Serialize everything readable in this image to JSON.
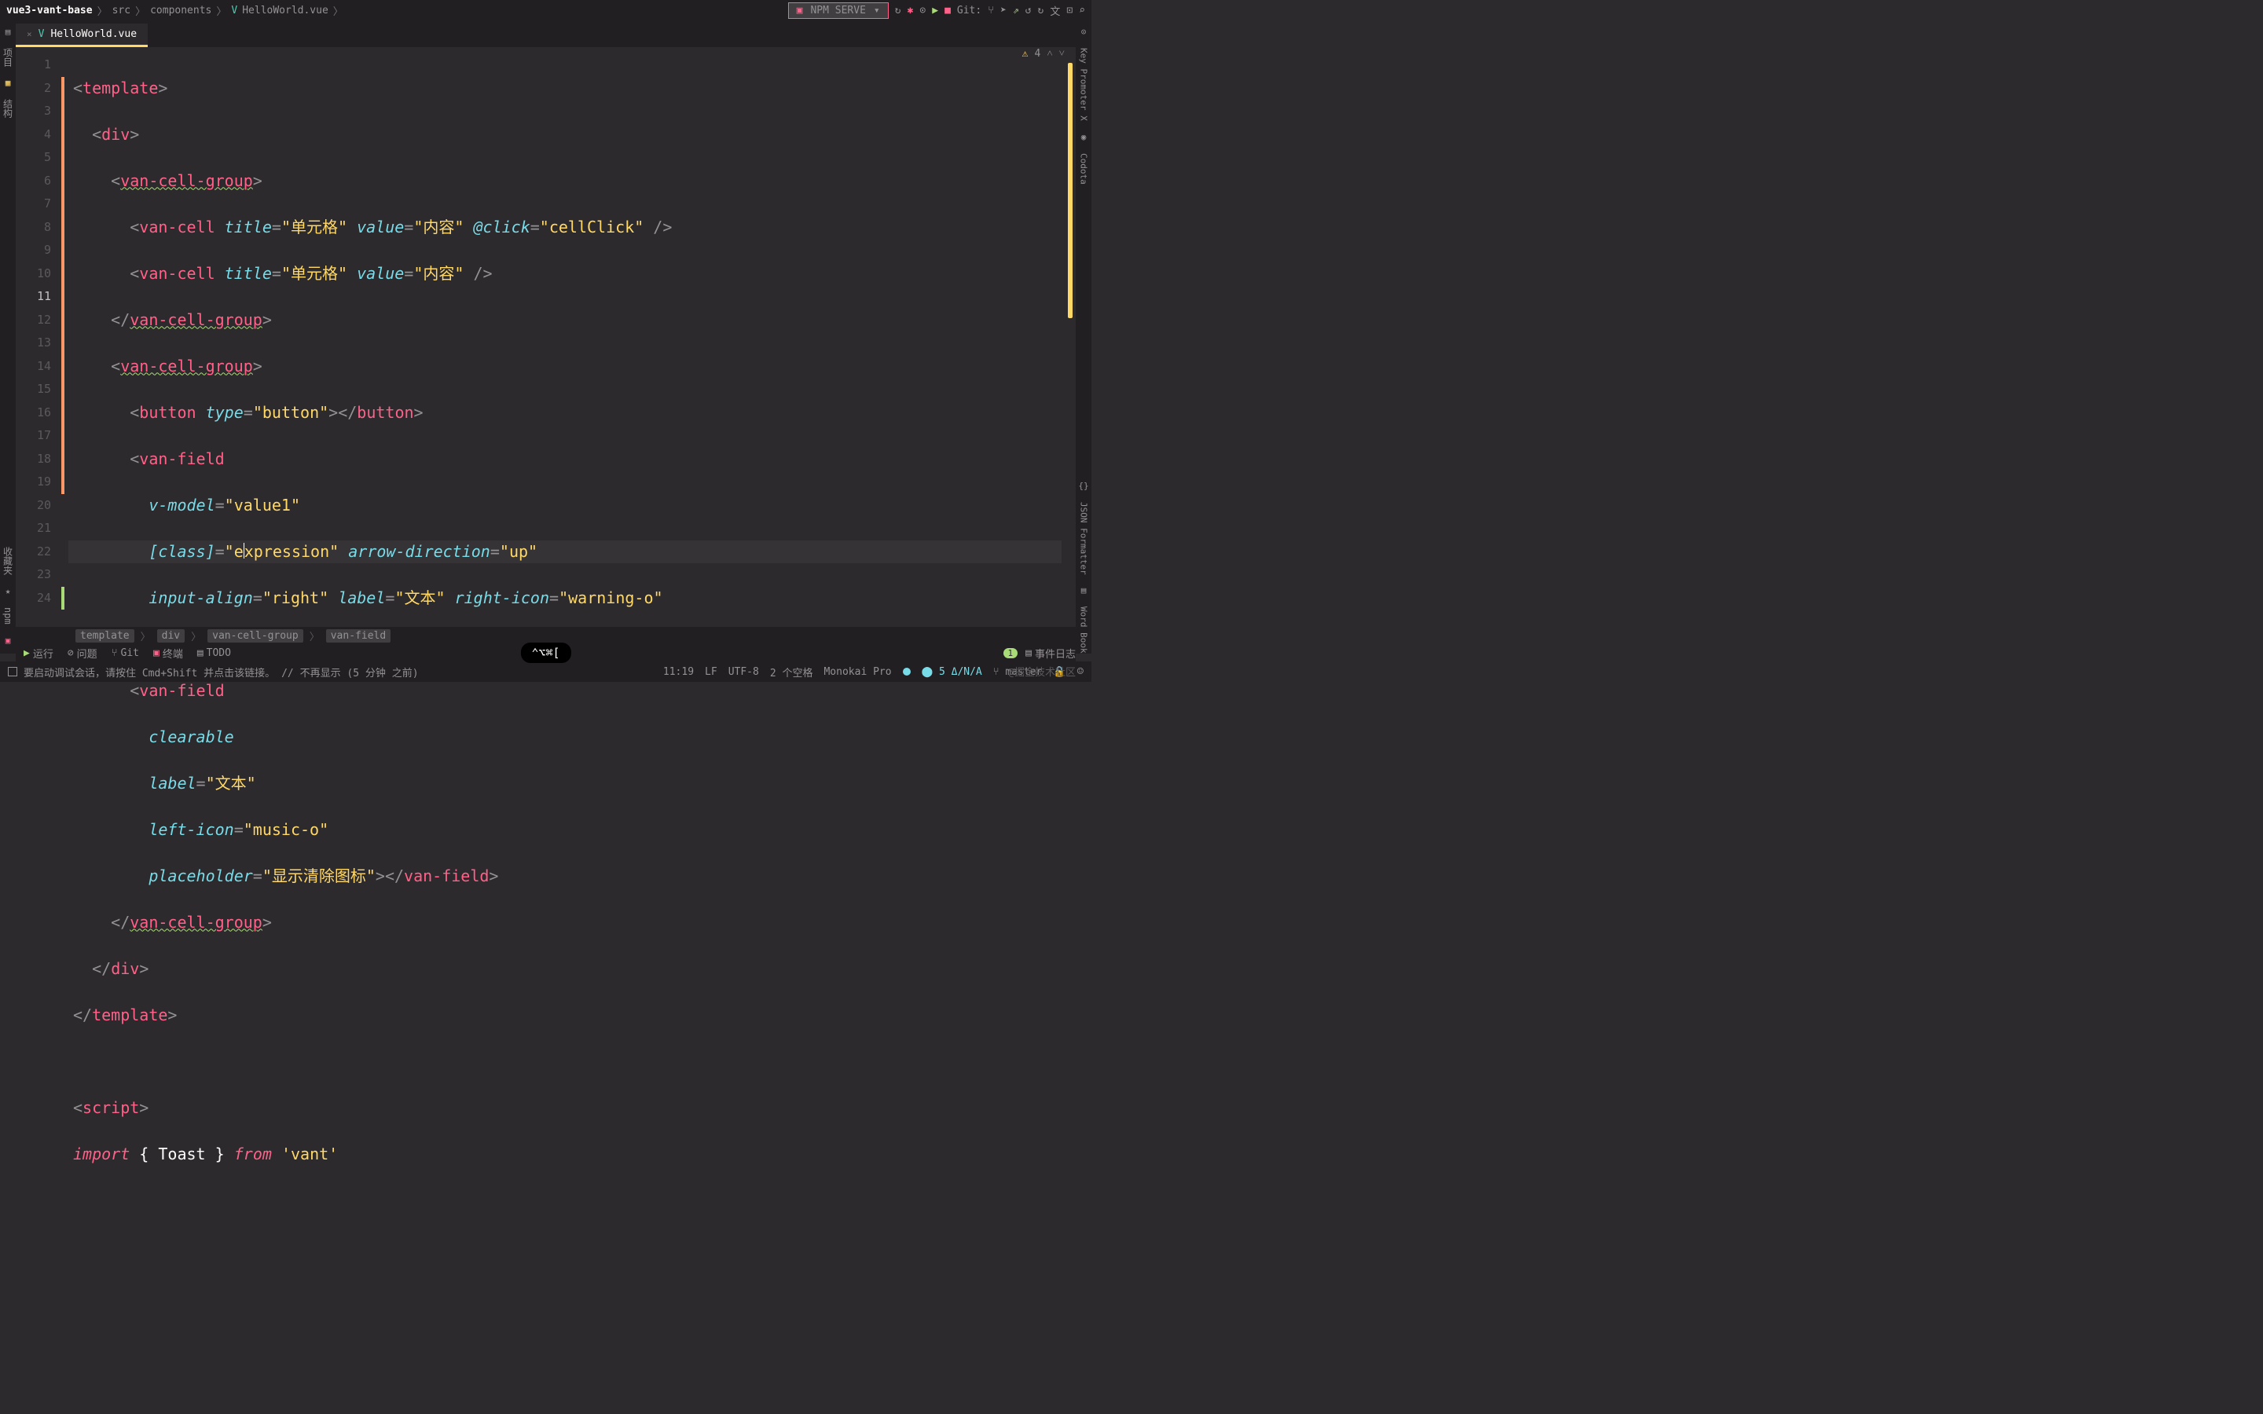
{
  "breadcrumbs": {
    "project": "vue3-vant-base",
    "path1": "src",
    "path2": "components",
    "file": "HelloWorld.vue"
  },
  "toolbar": {
    "npm_serve": "NPM SERVE",
    "git_label": "Git:"
  },
  "tab": {
    "filename": "HelloWorld.vue"
  },
  "inspection": {
    "warnings": "4"
  },
  "left_sidebar": {
    "tab1": "项目",
    "tab2": "结构",
    "tab_bottom1": "收藏夹",
    "tab_bottom2": "npm"
  },
  "right_sidebar": {
    "tab1": "Key Promoter X",
    "tab2": "Codota",
    "tab3": "JSON Formatter",
    "tab4": "Word Book"
  },
  "code": {
    "l1_tag": "template",
    "l2_tag": "div",
    "l3_tag": "van-cell-group",
    "l4_tag": "van-cell",
    "l4_attr1": "title",
    "l4_val1": "单元格",
    "l4_attr2": "value",
    "l4_val2": "内容",
    "l4_attr3": "@click",
    "l4_val3": "cellClick",
    "l5_tag": "van-cell",
    "l5_attr1": "title",
    "l5_val1": "单元格",
    "l5_attr2": "value",
    "l5_val2": "内容",
    "l8_tag": "button",
    "l8_attr1": "type",
    "l8_val1": "button",
    "l9_tag": "van-field",
    "l10_attr": "v-model",
    "l10_val": "value1",
    "l11_attr1": "[class]",
    "l11_val1": "expression",
    "l11_attr2": "arrow-direction",
    "l11_val2": "up",
    "l12_attr1": "input-align",
    "l12_val1": "right",
    "l12_attr2": "label",
    "l12_val2": "文本",
    "l12_attr3": "right-icon",
    "l12_val3": "warning-o",
    "l15_attr": "clearable",
    "l16_attr": "label",
    "l16_val": "文本",
    "l17_attr": "left-icon",
    "l17_val": "music-o",
    "l18_attr": "placeholder",
    "l18_val": "显示清除图标",
    "l23_tag": "script",
    "l24_import": "import",
    "l24_name": "Toast",
    "l24_from": "from",
    "l24_module": "'vant'"
  },
  "code_path": {
    "p1": "template",
    "p2": "div",
    "p3": "van-cell-group",
    "p4": "van-field"
  },
  "tool_bar": {
    "run": "运行",
    "problems": "问题",
    "git": "Git",
    "terminal": "终端",
    "todo": "TODO",
    "event_log": "事件日志",
    "event_count": "1"
  },
  "status": {
    "debug_hint": "要启动调试会话，请按住 Cmd+Shift 并点击该链接。",
    "no_show": "// 不再显示 (5 分钟 之前)",
    "position": "11:19",
    "line_sep": "LF",
    "encoding": "UTF-8",
    "indent": "2 个空格",
    "scheme": "Monokai Pro",
    "delta": "5 Δ/N/A",
    "branch": "master"
  },
  "shortcut": "⌃⌥⌘[",
  "watermark": "@掘金技术社区",
  "line_numbers": [
    "1",
    "2",
    "3",
    "4",
    "5",
    "6",
    "7",
    "8",
    "9",
    "10",
    "11",
    "12",
    "13",
    "14",
    "15",
    "16",
    "17",
    "18",
    "19",
    "20",
    "21",
    "22",
    "23",
    "24"
  ]
}
